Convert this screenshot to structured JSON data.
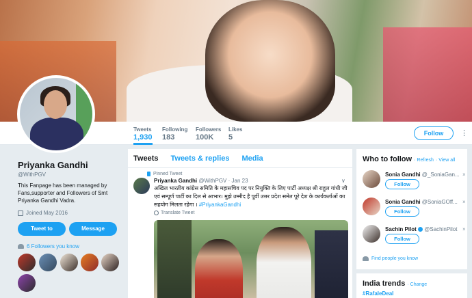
{
  "profile": {
    "name": "Priyanka Gandhi",
    "handle": "@WithPGV",
    "bio": "This Fanpage has been managed by Fans,supporter and Followers of Smt Priyanka Gandhi Vadra.",
    "joined": "Joined May 2016",
    "tweet_to_label": "Tweet to",
    "message_label": "Message",
    "followers_known": "6 Followers you know"
  },
  "stats": [
    {
      "label": "Tweets",
      "value": "1,930"
    },
    {
      "label": "Following",
      "value": "183"
    },
    {
      "label": "Followers",
      "value": "100K"
    },
    {
      "label": "Likes",
      "value": "5"
    }
  ],
  "header": {
    "follow_label": "Follow",
    "more": "⋮"
  },
  "tabs": {
    "tweets": "Tweets",
    "replies": "Tweets & replies",
    "media": "Media"
  },
  "tweet": {
    "pinned_label": "Pinned Tweet",
    "author": "Priyanka Gandhi",
    "meta": "@WithPGV · Jan 23",
    "text": "अखिल भारतीय कांग्रेस समिति के महासचिव पद पर नियुक्ति के लिए पार्टी अध्यक्ष श्री राहुल गांधी जी एवं सम्पूर्ण पार्टी का दिल से आभार। मुझे उम्मीद है पूर्वी उत्तर प्रदेश समेत पूरे देश के कार्यकर्ताओं का सहयोग मिलता रहेगा । ",
    "hashtag": "#PriyankaGandhi",
    "translate_label": "Translate Tweet",
    "chevron": "∨"
  },
  "who_to_follow": {
    "title": "Who to follow",
    "refresh": "· Refresh",
    "view_all": "· View all",
    "suggestions": [
      {
        "name": "Sonia Gandhi",
        "handle": "@_SoniaGan...",
        "follow": "Follow",
        "close": "×"
      },
      {
        "name": "Sonia Gandhi",
        "handle": "@SoniaGOff...",
        "follow": "Follow",
        "close": "×"
      },
      {
        "name": "Sachin Pilot",
        "handle": "@SachinPilot",
        "follow": "Follow",
        "close": "×"
      }
    ],
    "find_people": "Find people you know"
  },
  "trends": {
    "title": "India trends",
    "change": "· Change",
    "items": [
      "#RafaleDeal"
    ]
  }
}
